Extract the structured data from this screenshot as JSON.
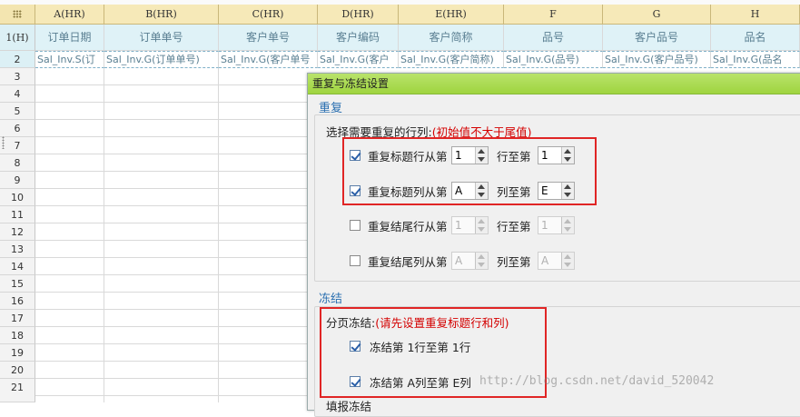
{
  "sheet": {
    "columns": [
      "A(HR)",
      "B(HR)",
      "C(HR)",
      "D(HR)",
      "E(HR)",
      "F",
      "G",
      "H"
    ],
    "rows": [
      "1(H)",
      "2",
      "3",
      "4",
      "5",
      "6",
      "7",
      "8",
      "9",
      "10",
      "11",
      "12",
      "13",
      "14",
      "15",
      "16",
      "17",
      "18",
      "19",
      "20",
      "21"
    ],
    "header_row": [
      "订单日期",
      "订单单号",
      "客户单号",
      "客户编码",
      "客户简称",
      "品号",
      "客户品号",
      "品名"
    ],
    "binding_row": [
      "Sal_Inv.S(订",
      "Sal_Inv.G(订单单号)",
      "Sal_Inv.G(客户单号",
      "Sal_Inv.G(客户",
      "Sal_Inv.G(客户简称)",
      "Sal_Inv.G(品号)",
      "Sal_Inv.G(客户品号)",
      "Sal_Inv.G(品名"
    ]
  },
  "dialog": {
    "title": "重复与冻结设置",
    "repeat": {
      "section_title": "重复",
      "prompt": "选择需要重复的行列:",
      "hint": "(初始值不大于尾值)",
      "rows": [
        {
          "label": "重复标题行从第",
          "to_label": "行至第",
          "checked": true,
          "from": "1",
          "to": "1",
          "enabled": true
        },
        {
          "label": "重复标题列从第",
          "to_label": "列至第",
          "checked": true,
          "from": "A",
          "to": "E",
          "enabled": true
        },
        {
          "label": "重复结尾行从第",
          "to_label": "行至第",
          "checked": false,
          "from": "1",
          "to": "1",
          "enabled": false
        },
        {
          "label": "重复结尾列从第",
          "to_label": "列至第",
          "checked": false,
          "from": "A",
          "to": "A",
          "enabled": false
        }
      ]
    },
    "freeze": {
      "section_title": "冻结",
      "prompt": "分页冻结:",
      "hint": "(请先设置重复标题行和列)",
      "items": [
        {
          "label": "冻结第 1行至第 1行",
          "checked": true
        },
        {
          "label": "冻结第 A列至第 E列",
          "checked": true
        }
      ],
      "next_section_partial": "填报冻结"
    }
  },
  "watermark": "http://blog.csdn.net/david_520042",
  "colors": {
    "title_bar": "#a6d84a",
    "header_band": "#dff2f7",
    "col_header": "#f6e9b8",
    "hint": "#d40000",
    "section": "#2a6fb0",
    "highlight": "#e02525"
  }
}
